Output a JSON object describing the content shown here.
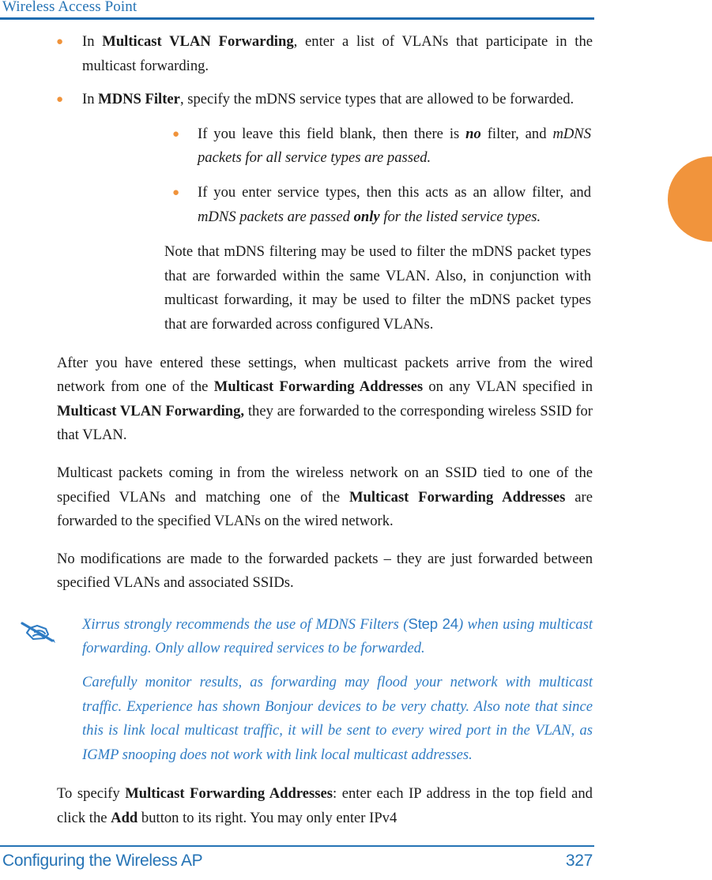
{
  "header": {
    "title": "Wireless Access Point",
    "rule_color": "#1f6cb0"
  },
  "edge_tab": {
    "name": "chapter-thumb-tab",
    "color": "#f1943c"
  },
  "accent_colors": {
    "bullet_orange": "#f0933b",
    "note_blue": "#2f7cc4",
    "header_blue": "#2573b5",
    "tab_orange": "#f1943c"
  },
  "content": {
    "bullets": [
      {
        "lead": "In ",
        "bold": "Multicast VLAN Forwarding",
        "rest": ", enter a list of VLANs that participate in the multicast forwarding."
      },
      {
        "lead": "In ",
        "bold": "MDNS Filter",
        "rest": ", specify the mDNS service types that are allowed to be forwarded."
      }
    ],
    "sub_bullets": [
      {
        "part1": "If you leave this field blank, then there is ",
        "emph1": "no",
        "part2": " filter, and ",
        "ital1": "mDNS packets for all service types are passed."
      },
      {
        "part1": "If you enter service types, then this acts as an allow filter, and ",
        "ital1": "mDNS packets are passed ",
        "emph1": "only",
        "ital2": " for the listed service types."
      }
    ],
    "note_paragraph": "Note that mDNS filtering may be used to filter the mDNS packet types that are forwarded within the same VLAN. Also, in conjunction with multicast forwarding, it may be used to filter the mDNS packet types that are forwarded across configured VLANs.",
    "paragraphs": [
      {
        "part1": "After you have entered these settings, when multicast packets arrive from the wired network from one of the ",
        "bold1": "Multicast Forwarding Addresses",
        "part2": " on any VLAN specified in ",
        "bold2": "Multicast VLAN Forwarding,",
        "part3": " they are forwarded to the corresponding wireless SSID for that VLAN."
      },
      {
        "part1": "Multicast packets coming in from the wireless network on an SSID tied to one of the specified VLANs and matching one of the ",
        "bold1": "Multicast Forwarding Addresses",
        "part2": " are forwarded to the specified VLANs on the wired network."
      },
      {
        "part1": "No modifications are made to the forwarded packets – they are just forwarded between specified VLANs and associated SSIDs."
      }
    ],
    "note_block": {
      "icon": "note-pencil-icon",
      "lines": [
        {
          "part1": "Xirrus strongly recommends the use of MDNS Filters (",
          "step_ref": "Step 24",
          "part2": ") when using multicast forwarding. Only allow required services to be forwarded."
        },
        {
          "part1": "Carefully monitor results, as forwarding may flood your network with multicast traffic. Experience has shown Bonjour devices to be very chatty. Also note that since this is link local multicast traffic, it will be sent to every wired port in the VLAN, as IGMP snooping does not work with link local multicast addresses."
        }
      ]
    },
    "final_paragraph": {
      "part1": "To specify ",
      "bold1": "Multicast Forwarding Addresses",
      "part2": ": enter each IP address in the top field and click the ",
      "bold2": "Add",
      "part3": " button to its right. You may only enter IPv4"
    }
  },
  "footer": {
    "text": "Configuring the Wireless AP",
    "page_number": "327"
  }
}
